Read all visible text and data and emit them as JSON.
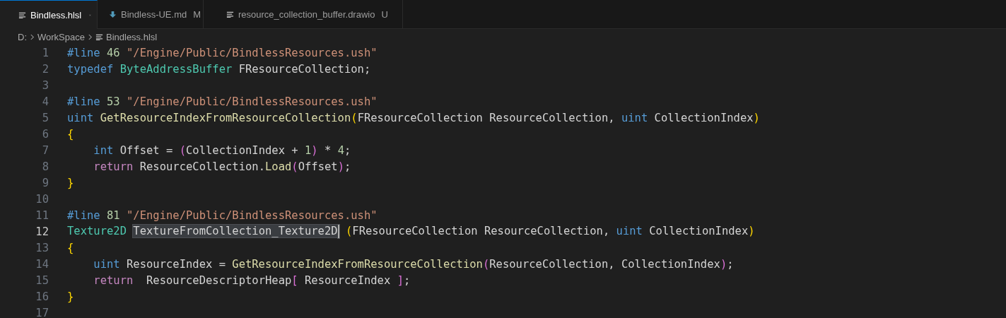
{
  "tabs": [
    {
      "label": "Bindless.hlsl",
      "kind": "lines",
      "selected": true
    },
    {
      "label": "Bindless-UE.md",
      "kind": "markdown",
      "selected": false,
      "decoration": "M"
    },
    {
      "label": "resource_collection_buffer.drawio",
      "kind": "lines",
      "selected": false,
      "decoration": "U"
    }
  ],
  "breadcrumbs": [
    {
      "label": "D:"
    },
    {
      "label": "WorkSpace"
    },
    {
      "label": "Bindless.hlsl",
      "kind": "lines"
    }
  ],
  "editor": {
    "lines": [
      {
        "number": "1",
        "current": false,
        "tokens": [
          {
            "kind": "keyword",
            "text": "#line "
          },
          {
            "kind": "number",
            "text": "46 "
          },
          {
            "kind": "string",
            "text": "\"/Engine/Public/BindlessResources.ush\""
          }
        ]
      },
      {
        "number": "2",
        "current": false,
        "tokens": [
          {
            "kind": "keyword",
            "text": "typedef "
          },
          {
            "kind": "type",
            "text": "ByteAddressBuffer"
          },
          {
            "kind": "plain",
            "text": " FResourceCollection;"
          }
        ]
      },
      {
        "number": "3",
        "current": false
      },
      {
        "number": "4",
        "current": false,
        "tokens": [
          {
            "kind": "keyword",
            "text": "#line "
          },
          {
            "kind": "number",
            "text": "53 "
          },
          {
            "kind": "string",
            "text": "\"/Engine/Public/BindlessResources.ush\""
          }
        ]
      },
      {
        "number": "5",
        "current": false,
        "tokens": [
          {
            "kind": "keyword",
            "text": "uint "
          },
          {
            "kind": "func",
            "text": "GetResourceIndexFromResourceCollection"
          },
          {
            "kind": "bracket1",
            "text": "("
          },
          {
            "kind": "plain",
            "text": "FResourceCollection ResourceCollection, "
          },
          {
            "kind": "keyword",
            "text": "uint"
          },
          {
            "kind": "plain",
            "text": " CollectionIndex"
          },
          {
            "kind": "bracket1",
            "text": ")"
          }
        ]
      },
      {
        "number": "6",
        "current": false,
        "tokens": [
          {
            "kind": "bracket1",
            "text": "{"
          }
        ]
      },
      {
        "number": "7",
        "current": false,
        "tokens": [
          {
            "kind": "keyword",
            "text": "    int"
          },
          {
            "kind": "plain",
            "text": " Offset = "
          },
          {
            "kind": "bracket2",
            "text": "("
          },
          {
            "kind": "plain",
            "text": "CollectionIndex + "
          },
          {
            "kind": "number",
            "text": "1"
          },
          {
            "kind": "bracket2",
            "text": ")"
          },
          {
            "kind": "plain",
            "text": " * "
          },
          {
            "kind": "number",
            "text": "4"
          },
          {
            "kind": "plain",
            "text": ";"
          }
        ]
      },
      {
        "number": "8",
        "current": false,
        "tokens": [
          {
            "kind": "control",
            "text": "    return"
          },
          {
            "kind": "plain",
            "text": " ResourceCollection."
          },
          {
            "kind": "func",
            "text": "Load"
          },
          {
            "kind": "bracket2",
            "text": "("
          },
          {
            "kind": "plain",
            "text": "Offset"
          },
          {
            "kind": "bracket2",
            "text": ")"
          },
          {
            "kind": "plain",
            "text": ";"
          }
        ]
      },
      {
        "number": "9",
        "current": false,
        "tokens": [
          {
            "kind": "bracket1",
            "text": "}"
          }
        ]
      },
      {
        "number": "10",
        "current": false
      },
      {
        "number": "11",
        "current": false,
        "tokens": [
          {
            "kind": "keyword",
            "text": "#line "
          },
          {
            "kind": "number",
            "text": "81 "
          },
          {
            "kind": "string",
            "text": "\"/Engine/Public/BindlessResources.ush\""
          }
        ]
      },
      {
        "number": "12",
        "current": true,
        "tokens": [
          {
            "kind": "type",
            "text": "Texture2D "
          },
          {
            "kind": "selection",
            "text": "TextureFromCollection_Texture2D"
          },
          {
            "kind": "bracket1",
            "text": " ("
          },
          {
            "kind": "plain",
            "text": "FResourceCollection ResourceCollection, "
          },
          {
            "kind": "keyword",
            "text": "uint"
          },
          {
            "kind": "plain",
            "text": " CollectionIndex"
          },
          {
            "kind": "bracket1",
            "text": ")"
          }
        ]
      },
      {
        "number": "13",
        "current": false,
        "tokens": [
          {
            "kind": "bracket1",
            "text": "{"
          }
        ]
      },
      {
        "number": "14",
        "current": false,
        "tokens": [
          {
            "kind": "keyword",
            "text": "    uint"
          },
          {
            "kind": "plain",
            "text": " ResourceIndex = "
          },
          {
            "kind": "func",
            "text": "GetResourceIndexFromResourceCollection"
          },
          {
            "kind": "bracket2",
            "text": "("
          },
          {
            "kind": "plain",
            "text": "ResourceCollection, CollectionIndex"
          },
          {
            "kind": "bracket2",
            "text": ")"
          },
          {
            "kind": "plain",
            "text": ";"
          }
        ]
      },
      {
        "number": "15",
        "current": false,
        "tokens": [
          {
            "kind": "control",
            "text": "    return"
          },
          {
            "kind": "plain",
            "text": "  ResourceDescriptorHeap"
          },
          {
            "kind": "bracket2",
            "text": "["
          },
          {
            "kind": "plain",
            "text": " ResourceIndex "
          },
          {
            "kind": "bracket2",
            "text": "]"
          },
          {
            "kind": "plain",
            "text": ";"
          }
        ]
      },
      {
        "number": "16",
        "current": false,
        "tokens": [
          {
            "kind": "bracket1",
            "text": "}"
          }
        ]
      },
      {
        "number": "17",
        "current": false
      }
    ]
  }
}
